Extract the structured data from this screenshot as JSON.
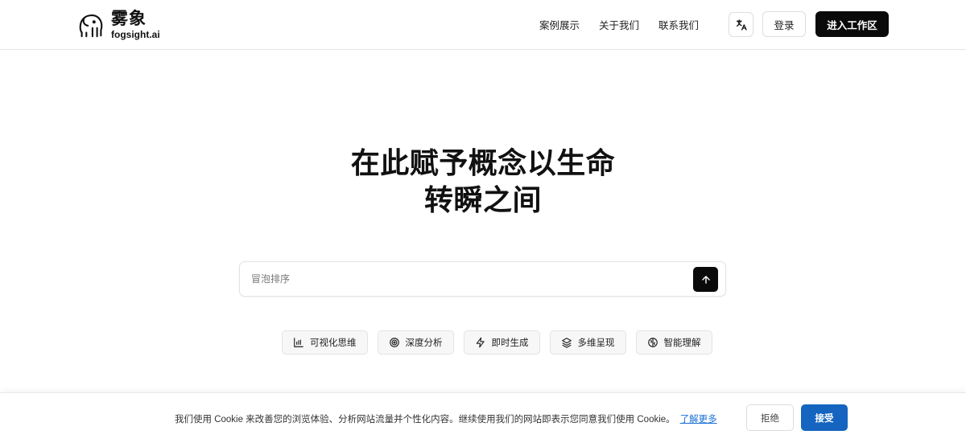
{
  "header": {
    "logo_cn": "雾象",
    "logo_en": "fogsight.ai",
    "nav": [
      {
        "label": "案例展示"
      },
      {
        "label": "关于我们"
      },
      {
        "label": "联系我们"
      }
    ],
    "language_icon": "translate-icon",
    "login_label": "登录",
    "workspace_label": "进入工作区"
  },
  "hero": {
    "line1": "在此赋予概念以生命",
    "line2": "转瞬之间"
  },
  "search": {
    "placeholder": "冒泡排序",
    "submit_icon": "arrow-up-icon"
  },
  "features": [
    {
      "label": "可视化思维",
      "icon": "bar-chart-icon"
    },
    {
      "label": "深度分析",
      "icon": "target-icon"
    },
    {
      "label": "即时生成",
      "icon": "lightning-icon"
    },
    {
      "label": "多维呈现",
      "icon": "layers-icon"
    },
    {
      "label": "智能理解",
      "icon": "brain-icon"
    }
  ],
  "cookie": {
    "message": "我们使用 Cookie 来改善您的浏览体验、分析网站流量并个性化内容。继续使用我们的网站即表示您同意我们使用 Cookie。",
    "link_label": "了解更多",
    "reject_label": "拒绝",
    "accept_label": "接受"
  },
  "colors": {
    "primary_dark": "#0a0a0a",
    "accept_blue": "#1565c0",
    "link_blue": "#1a6fd6"
  }
}
